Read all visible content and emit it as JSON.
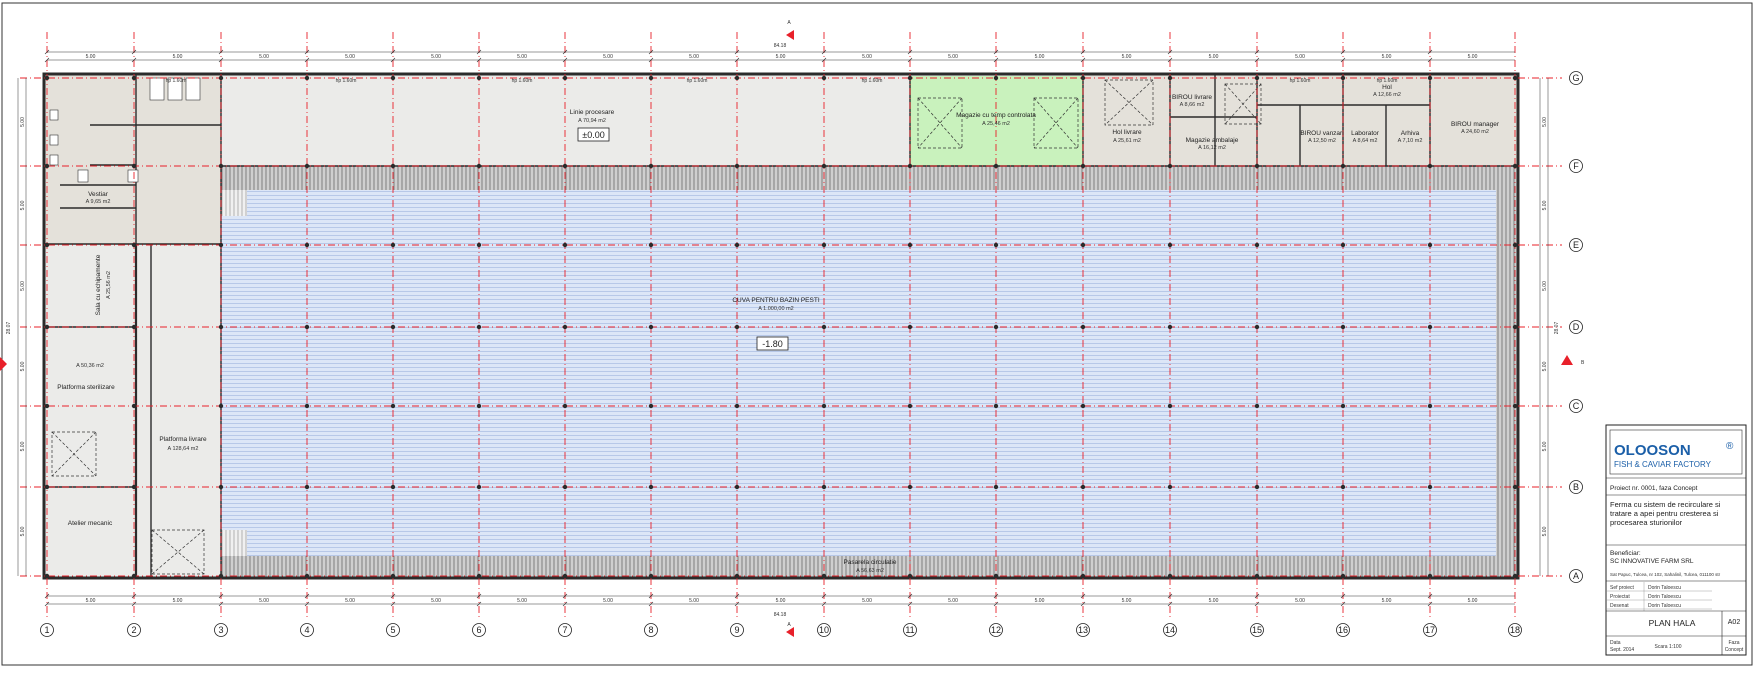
{
  "axes": {
    "numbers": [
      "1",
      "2",
      "3",
      "4",
      "5",
      "6",
      "7",
      "8",
      "9",
      "10",
      "11",
      "12",
      "13",
      "14",
      "15",
      "16",
      "17",
      "18"
    ],
    "letters": [
      "G",
      "F",
      "E",
      "D",
      "C",
      "B",
      "A"
    ]
  },
  "dimensions": {
    "total_length": "84.18",
    "total_width": "28.07",
    "bay": "5.00"
  },
  "section_marks": {
    "vertical": "A",
    "horizontal": "B"
  },
  "rooms": {
    "pool": {
      "name": "CUVA PENTRU BAZIN PESTI",
      "area": "A 1.000,00 m2",
      "level": "-1.80"
    },
    "processing": {
      "name": "Linie procesare",
      "area": "A 70,94 m2",
      "level": "±0.00"
    },
    "controlled_storage": {
      "name": "Magazie cu temp controlata",
      "area": "A 25,46 m2"
    },
    "hall_wagons": {
      "name": "Hol livrare",
      "area": "A 25,61 m2"
    },
    "packaging": {
      "name": "Magazie ambalaje",
      "area": "A 16,12 m2"
    },
    "office_sales": {
      "name": "BIROU livrare",
      "area": "A 8,66 m2"
    },
    "office_vanzari": {
      "name": "BIROU vanzari",
      "area": "A 12,50 m2"
    },
    "lab": {
      "name": "Laborator",
      "area": "A 8,64 m2"
    },
    "archive": {
      "name": "Arhiva",
      "area": "A 7,10 m2"
    },
    "hall": {
      "name": "Hol",
      "area": "A 12,66 m2"
    },
    "office_manager": {
      "name": "BIROU manager",
      "area": "A 24,60 m2"
    },
    "tech_room": {
      "name": "Sala cu echipamente",
      "area": "A 25,56 m2"
    },
    "filtration": {
      "name": "Platforma sterilizare",
      "area": "A 50,36 m2"
    },
    "delivery_platform": {
      "name": "Platforma livrare",
      "area": "A 128,64 m2"
    },
    "workshop": {
      "name": "Atelier mecanic",
      "area": ""
    },
    "walkway": {
      "name": "Pasarela circulatie",
      "area": "A 56,63 m2"
    },
    "changing": {
      "name": "Vestiar",
      "area": "A 9,65 m2"
    },
    "hp_label": "hp 1.60m"
  },
  "title_block": {
    "logo_main": "OLOOSON",
    "logo_reg": "®",
    "logo_sub": "FISH & CAVIAR FACTORY",
    "project_no": "Proiect nr. 0001, faza Concept",
    "project_title_1": "Ferma cu sistem de recirculare si",
    "project_title_2": "tratare a apei pentru cresterea si",
    "project_title_3": "procesarea sturionilor",
    "beneficiary_label": "Beneficiar:",
    "beneficiary": "SC INNOVATIVE FARM SRL",
    "address": "Sat Papuc, Tulcea, nr 102, Sahalinil, Tulcea, 011100 str",
    "roles": [
      {
        "role": "Sef proiect",
        "name": "Dorin Taloescu"
      },
      {
        "role": "Proiectat",
        "name": "Dorin Taloescu"
      },
      {
        "role": "Desenat",
        "name": "Dorin Taloescu"
      }
    ],
    "sheet_title": "PLAN HALA",
    "sheet_no": "A02",
    "date_label": "Data",
    "date": "Sept. 2014",
    "scale": "Scara 1:100",
    "phase_label": "Faza",
    "phase": "Concept"
  },
  "colors": {
    "grid": "#e8202a",
    "pool": "#dce6f7",
    "pool_lines": "#8fa8d8",
    "floor": "#ebebe9",
    "rooms": "#e4e1da",
    "green_room": "#c9f2bd",
    "wall": "#2b2b2b",
    "logo_blue": "#1b5fa8"
  }
}
